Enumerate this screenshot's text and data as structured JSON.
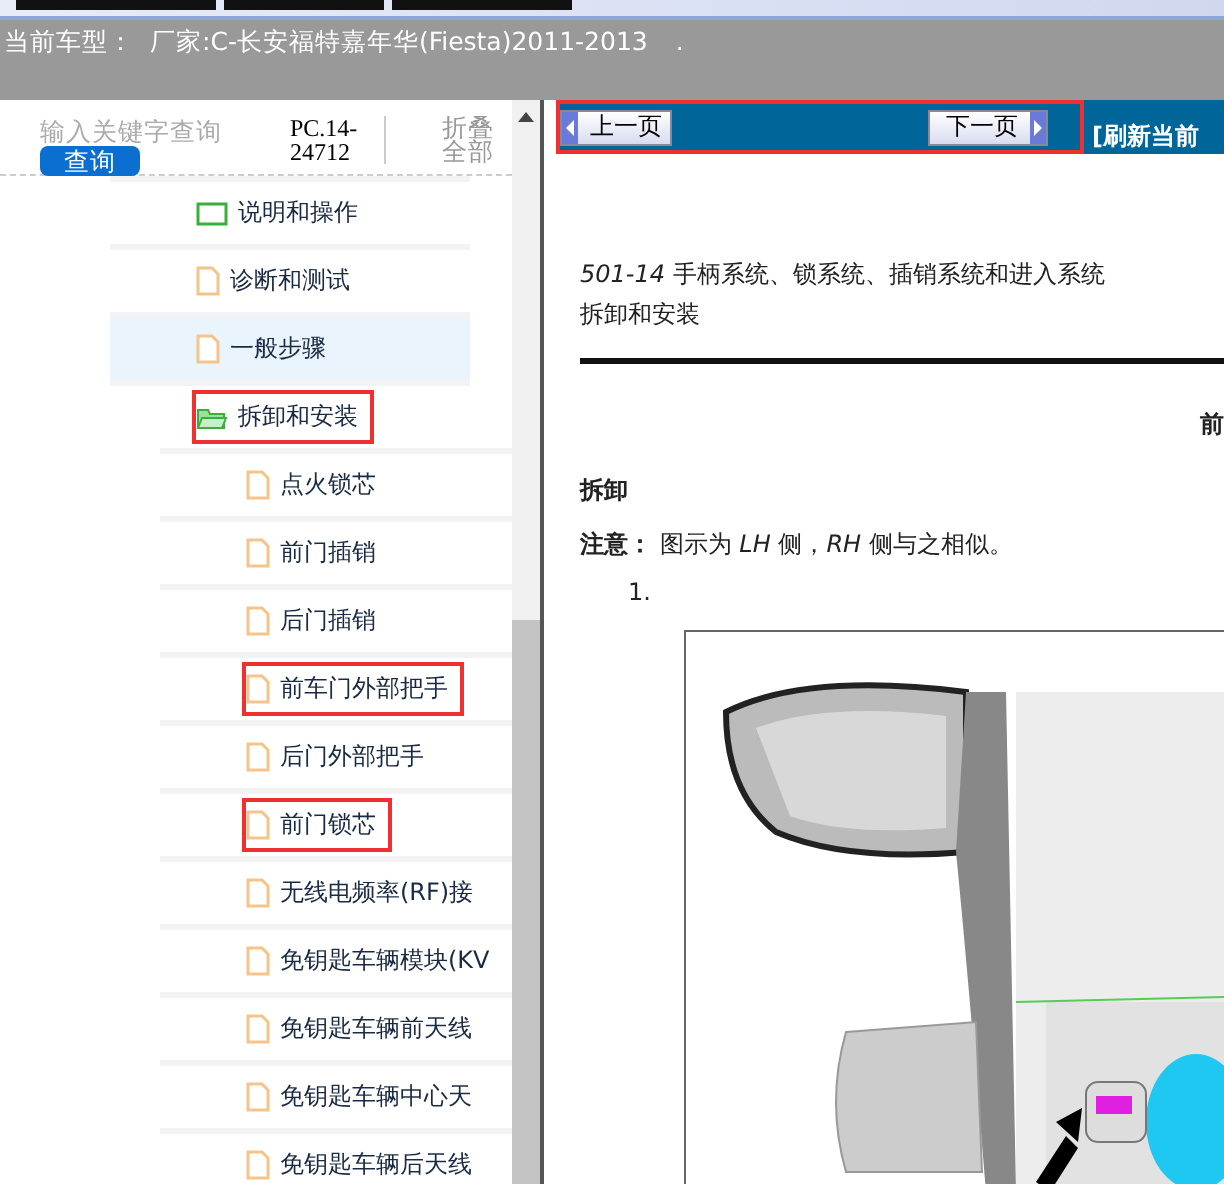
{
  "model_bar": {
    "label": "当前车型：",
    "value": "厂家:C-长安福特嘉年华(Fiesta)2011-2013",
    "dot": "."
  },
  "search": {
    "placeholder": "输入关键字查询",
    "button": "查询",
    "code": "PC.14-24712",
    "collapse": "折叠全部"
  },
  "tree": [
    {
      "label": "说明和操作",
      "kind": "folder",
      "expanded": false,
      "selected": false,
      "marked": false
    },
    {
      "label": "诊断和测试",
      "kind": "doc",
      "selected": false,
      "marked": false
    },
    {
      "label": "一般步骤",
      "kind": "doc",
      "selected": true,
      "marked": false
    },
    {
      "label": "拆卸和安装",
      "kind": "folder",
      "expanded": true,
      "selected": false,
      "marked": true,
      "children": [
        {
          "label": "点火锁芯",
          "kind": "doc",
          "selected": false,
          "marked": false
        },
        {
          "label": "前门插销",
          "kind": "doc",
          "selected": false,
          "marked": false
        },
        {
          "label": "后门插销",
          "kind": "doc",
          "selected": false,
          "marked": false
        },
        {
          "label": "前车门外部把手",
          "kind": "doc",
          "selected": false,
          "marked": true
        },
        {
          "label": "后门外部把手",
          "kind": "doc",
          "selected": false,
          "marked": false
        },
        {
          "label": "前门锁芯",
          "kind": "doc",
          "selected": false,
          "marked": true
        },
        {
          "label": "无线电频率(RF)接",
          "kind": "doc",
          "selected": false,
          "marked": false
        },
        {
          "label": "免钥匙车辆模块(KV",
          "kind": "doc",
          "selected": false,
          "marked": false
        },
        {
          "label": "免钥匙车辆前天线",
          "kind": "doc",
          "selected": false,
          "marked": false
        },
        {
          "label": "免钥匙车辆中心天",
          "kind": "doc",
          "selected": false,
          "marked": false
        },
        {
          "label": "免钥匙车辆后天线",
          "kind": "doc",
          "selected": false,
          "marked": false
        }
      ]
    }
  ],
  "nav": {
    "prev": "上一页",
    "next": "下一页",
    "refresh": "[刷新当前",
    "marked": true
  },
  "document": {
    "heading": "*501-14* 手柄系统、锁系统、插销系统和进入系统",
    "subheading": "拆卸和安装",
    "title": "前",
    "section": "拆卸",
    "note": "**注意：** 图示为 *LH* 侧，*RH* 侧与之相似。",
    "step": "1."
  }
}
